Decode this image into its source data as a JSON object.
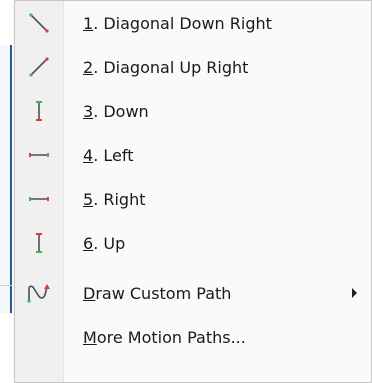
{
  "menu": {
    "items": [
      {
        "accel": "1",
        "rest": ". Diagonal Down Right",
        "icon": "diagonal-down-right-icon"
      },
      {
        "accel": "2",
        "rest": ". Diagonal Up Right",
        "icon": "diagonal-up-right-icon"
      },
      {
        "accel": "3",
        "rest": ". Down",
        "icon": "down-path-icon"
      },
      {
        "accel": "4",
        "rest": ". Left",
        "icon": "left-path-icon"
      },
      {
        "accel": "5",
        "rest": ". Right",
        "icon": "right-path-icon"
      },
      {
        "accel": "6",
        "rest": ". Up",
        "icon": "up-path-icon"
      },
      {
        "accel": "D",
        "rest": "raw Custom Path",
        "icon": "custom-path-icon",
        "has_submenu": true
      },
      {
        "accel": "M",
        "rest": "ore Motion Paths...",
        "icon": ""
      }
    ]
  },
  "colors": {
    "path_line": "#4f4f4f",
    "start_marker": "#4caf50",
    "end_marker": "#e53935",
    "accent_border": "#2b579a"
  }
}
